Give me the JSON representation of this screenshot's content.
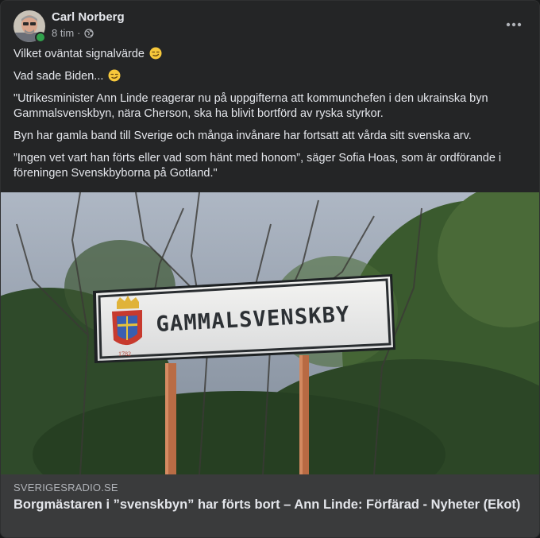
{
  "post": {
    "author": "Carl Norberg",
    "time": "8 tim",
    "meta_separator": "·",
    "paragraphs": [
      "Vilket oväntat signalvärde",
      "Vad sade Biden...",
      "\"Utrikesminister Ann Linde reagerar nu på uppgifterna att kommunchefen i den ukrainska byn Gammalsvenskbyn, nära Cherson, ska ha blivit bortförd av ryska styrkor.",
      "Byn har gamla band till Sverige och många invånare har fortsatt att vårda sitt svenska arv.",
      "”Ingen vet vart han förts eller vad som hänt med honom”, säger Sofia Hoas, som är ordförande i föreningen Svenskbyborna på Gotland.\""
    ]
  },
  "link": {
    "domain": "SVERIGESRADIO.SE",
    "headline": "Borgmästaren i ”svenskbyn” har förts bort – Ann Linde: Förfärad - Nyheter (Ekot)",
    "sign_text": "GAMMALSVENSKBY",
    "crest_year": "1782"
  },
  "icons": {
    "privacy": "globe-icon",
    "more": "more-horizontal-icon",
    "emoji": "smirk-emoji-icon"
  },
  "colors": {
    "card": "#242526",
    "text": "#e4e6eb",
    "secondary": "#b0b3b8",
    "online": "#31a24c",
    "link_footer": "#3a3b3c"
  }
}
